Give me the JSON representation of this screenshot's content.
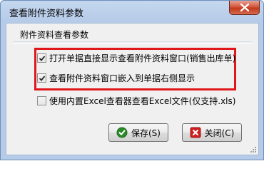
{
  "window": {
    "title": "查看附件资料参数"
  },
  "group": {
    "title": "附件资料查看参数"
  },
  "options": [
    {
      "label": "打开单据直接显示查看附件资料窗口(销售出库单)",
      "checked": true
    },
    {
      "label": "查看附件资料窗口嵌入到单据右侧显示",
      "checked": true
    },
    {
      "label": "使用内置Excel查看器查看Excel文件(仅支持.xls)",
      "checked": false
    }
  ],
  "buttons": {
    "save": "保存(S)",
    "close": "关闭(C)"
  },
  "colors": {
    "highlight": "#e0171b",
    "save_icon": "#2a8a2a",
    "close_icon": "#d02020"
  }
}
